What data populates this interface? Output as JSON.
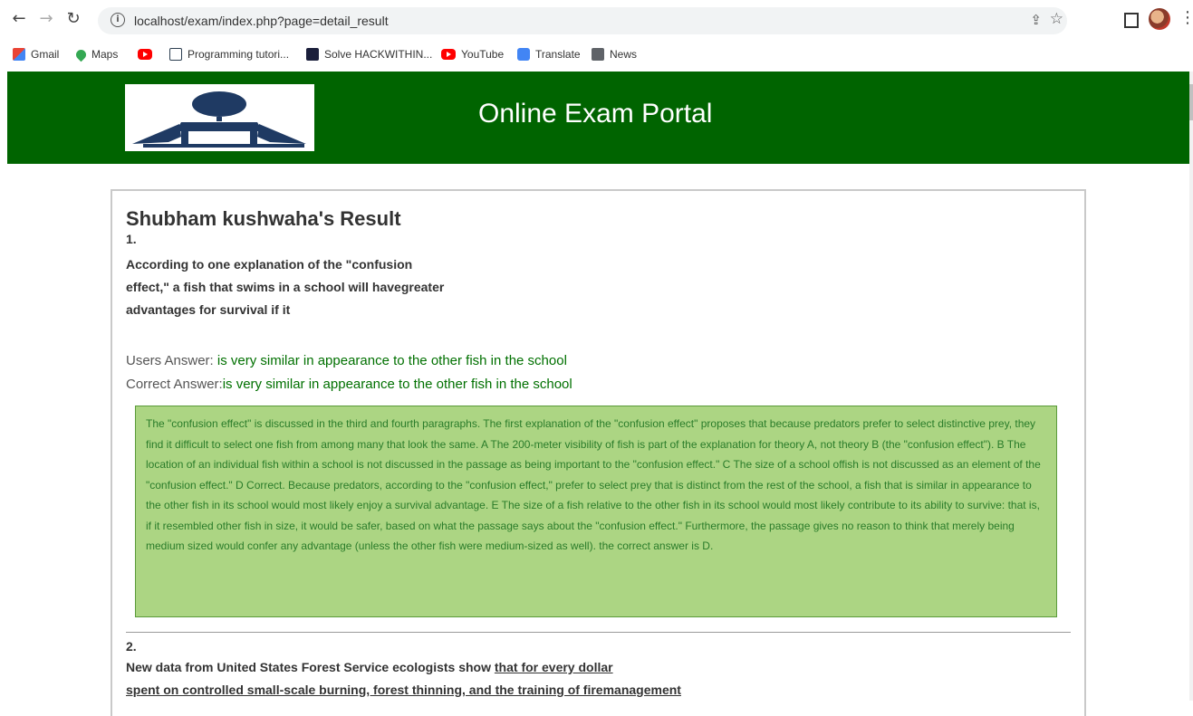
{
  "browser": {
    "url": "localhost/exam/index.php?page=detail_result",
    "bookmarks": [
      {
        "label": "Gmail",
        "icon": "gmail-icon"
      },
      {
        "label": "Maps",
        "icon": "maps-icon"
      },
      {
        "label": "",
        "icon": "youtube-icon"
      },
      {
        "label": "Programming tutori...",
        "icon": "tutorial-icon"
      },
      {
        "label": "Solve HACKWITHIN...",
        "icon": "hackerrank-icon"
      },
      {
        "label": "YouTube",
        "icon": "youtube-icon"
      },
      {
        "label": "Translate",
        "icon": "translate-icon"
      },
      {
        "label": "News",
        "icon": "news-icon"
      }
    ]
  },
  "header": {
    "title": "Online Exam Portal",
    "brand_color": "#006400"
  },
  "result": {
    "title": "Shubham kushwaha's Result",
    "q1": {
      "number": "1.",
      "lines": [
        "According to one explanation of the \"confusion",
        "effect,\" a fish that swims in a school will havegreater",
        "advantages for survival if it"
      ],
      "user_label": "Users Answer: ",
      "user_answer": "is very similar in appearance to the other fish in the school",
      "correct_label": "Correct Answer:",
      "correct_answer": "is very similar in appearance to the other fish in the school",
      "explanation": "The \"confusion effect\" is discussed in the third and fourth paragraphs. The first explanation of the \"confusion effect\" proposes that because predators prefer to select distinctive prey, they find it difficult to select one fish from among many that look the same. A The 200-meter visibility of fish is part of the explanation for theory A, not theory B (the \"confusion effect\"). B The location of an individual fish within a school is not discussed in the passage as being important to the \"confusion effect.\" C The size of a school offish is not discussed as an element of the \"confusion effect.\" D Correct. Because predators, according to the \"confusion effect,\" prefer to select prey that is distinct from the rest of the school, a fish that is similar in appearance to the other fish in its school would most likely enjoy a survival advantage. E The size of a fish relative to the other fish in its school would most likely contribute to its ability to survive: that is, if it resembled other fish in size, it would be safer, based on what the passage says about the \"confusion effect.\" Furthermore, the passage gives no reason to think that merely being medium sized would confer any advantage (unless the other fish were medium-sized as well). the correct answer is D."
    },
    "q2": {
      "number": "2.",
      "line1_plain": "New data from United States Forest Service ecologists show ",
      "line1_underlined": "that for every dollar",
      "line2_underlined": "spent on controlled small-scale burning, forest thinning, and the training of firemanagement"
    }
  }
}
